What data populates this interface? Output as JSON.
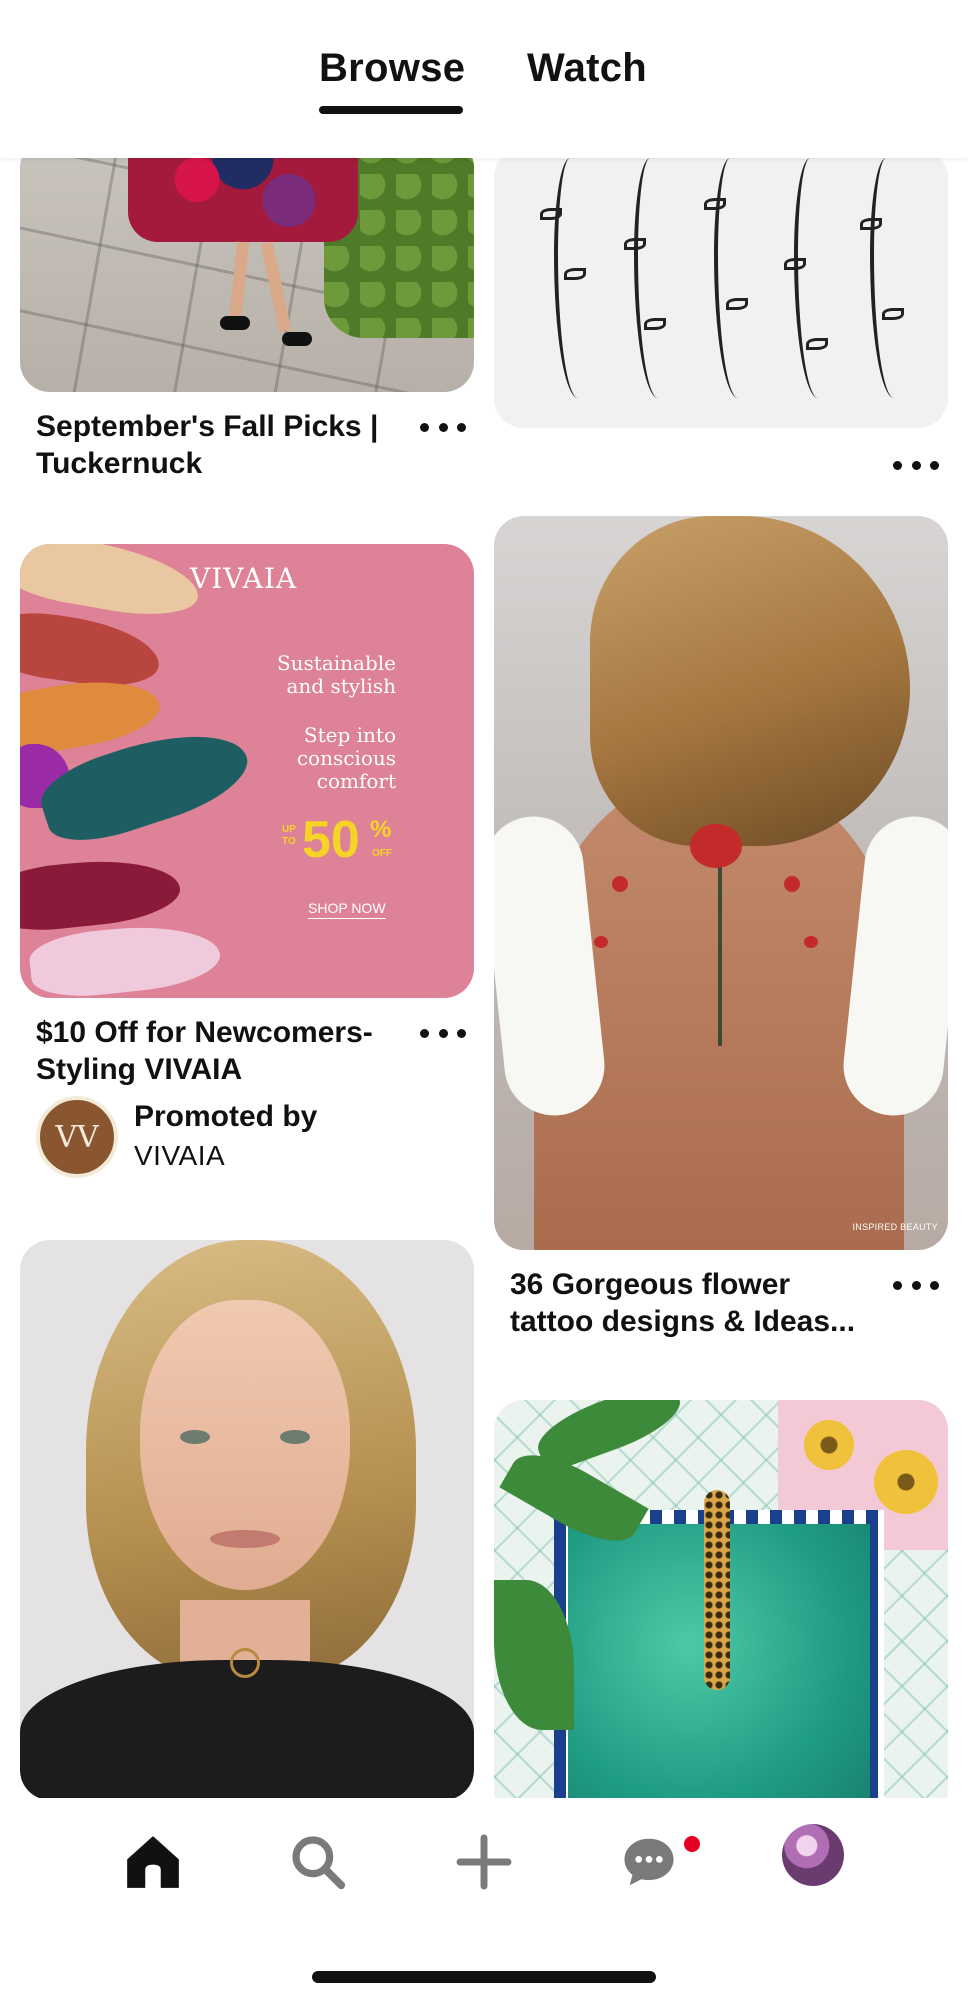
{
  "top_tabs": {
    "browse": "Browse",
    "watch": "Watch",
    "active": "Browse"
  },
  "feed": {
    "pins": [
      {
        "title_line1": "September's Fall Picks |",
        "title_line2": "Tuckernuck"
      },
      {
        "title_line1": "",
        "title_line2": ""
      },
      {
        "title_line1": "$10 Off for Newcomers-",
        "title_line2": "Styling VIVAIA",
        "promoted_label": "Promoted by",
        "promoter": "VIVAIA",
        "ad": {
          "brand": "VIVAIA",
          "line1": "Sustainable",
          "line2": "and stylish",
          "line3": "Step into",
          "line4": "conscious",
          "line5": "comfort",
          "up_to": "UP",
          "to": "TO",
          "discount": "50",
          "percent": "%",
          "off": "OFF",
          "cta": "SHOP NOW",
          "shoe_brand": "VIVAIA"
        },
        "avatar_monogram": "VV"
      },
      {
        "title_line1": "36 Gorgeous flower",
        "title_line2": "tattoo designs & Ideas...",
        "image_credit": "INSPIRED BEAUTY"
      },
      {
        "title_line1": "",
        "title_line2": ""
      },
      {
        "title_line1": "",
        "title_line2": ""
      }
    ]
  },
  "bottom_nav": {
    "items": [
      "home-icon",
      "search-icon",
      "create-icon",
      "messages-icon",
      "profile-avatar"
    ],
    "active": "home-icon",
    "notification_dot_color": "#e60023"
  },
  "colors": {
    "accent": "#e60023",
    "text": "#111111"
  }
}
